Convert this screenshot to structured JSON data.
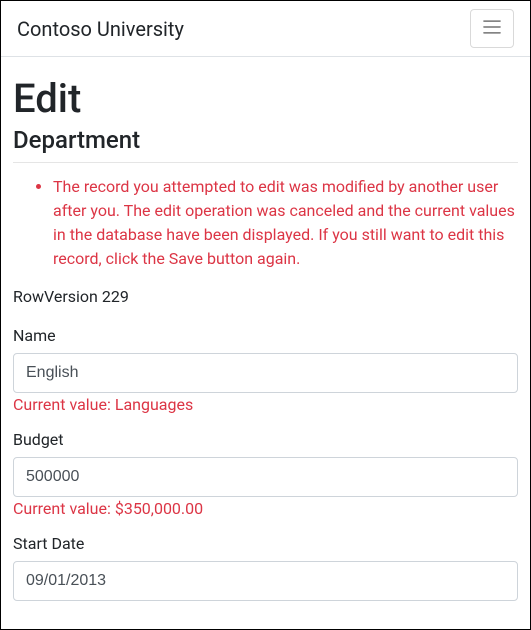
{
  "navbar": {
    "brand": "Contoso University",
    "toggler_label": "Toggle navigation"
  },
  "page": {
    "title": "Edit",
    "subtitle": "Department"
  },
  "validation": {
    "summary": "The record you attempted to edit was modified by another user after you. The edit operation was canceled and the current values in the database have been displayed. If you still want to edit this record, click the Save button again."
  },
  "rowversion": {
    "label": "RowVersion",
    "value": "229"
  },
  "form": {
    "name": {
      "label": "Name",
      "value": "English",
      "error": "Current value: Languages"
    },
    "budget": {
      "label": "Budget",
      "value": "500000",
      "error": "Current value: $350,000.00"
    },
    "start_date": {
      "label": "Start Date",
      "value": "09/01/2013"
    }
  }
}
